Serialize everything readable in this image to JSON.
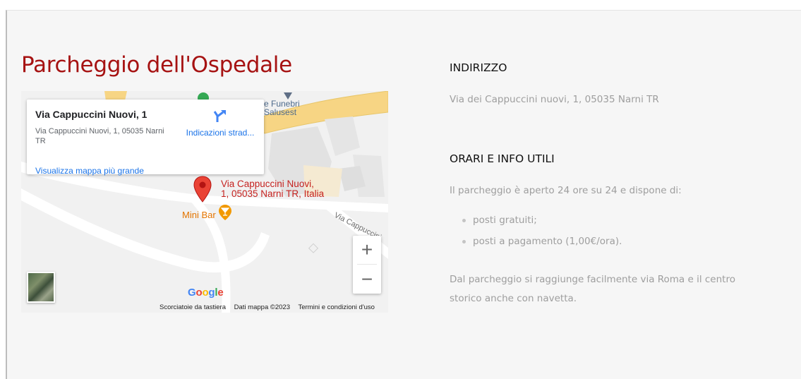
{
  "title": "Parcheggio dell'Ospedale",
  "map": {
    "card_title": "Via Cappuccini Nuovi, 1",
    "card_address": "Via Cappuccini Nuovi, 1, 05035 Narni TR",
    "card_link": "Visualizza mappa più grande",
    "directions_label": "Indicazioni strad...",
    "pin_label_line1": "Via Cappuccini Nuovi,",
    "pin_label_line2": "1, 05035 Narni TR, Italia",
    "place_minibar": "Mini Bar",
    "place_funebri_line1": "e Funebri",
    "place_funebri_line2": "Salusest",
    "road_label": "Via Cappuccini",
    "zoom_in": "+",
    "zoom_out": "−",
    "google_logo": "Google",
    "footer": {
      "shortcuts": "Scorciatoie da tastiera",
      "data": "Dati mappa ©2023",
      "terms": "Termini e condizioni d'uso"
    },
    "colors": {
      "pin": "#ea4335",
      "pin_label": "#c5221f",
      "minibar": "#e37400",
      "link": "#1a73e8",
      "road_major": "#f7d584"
    }
  },
  "address": {
    "heading": "INDIRIZZO",
    "text": "Via dei Cappuccini nuovi, 1, 05035 Narni TR"
  },
  "hours": {
    "heading": "ORARI E INFO UTILI",
    "intro": "Il parcheggio è aperto 24 ore su 24 e dispone di:",
    "items": [
      "posti gratuiti;",
      "posti a pagamento (1,00€/ora)."
    ],
    "note": "Dal parcheggio si raggiunge facilmente via Roma e il centro storico anche con navetta."
  },
  "colors": {
    "title": "#a61212",
    "heading": "#111111",
    "body": "#9e9e9e",
    "panel_bg": "#f6f6f6"
  }
}
